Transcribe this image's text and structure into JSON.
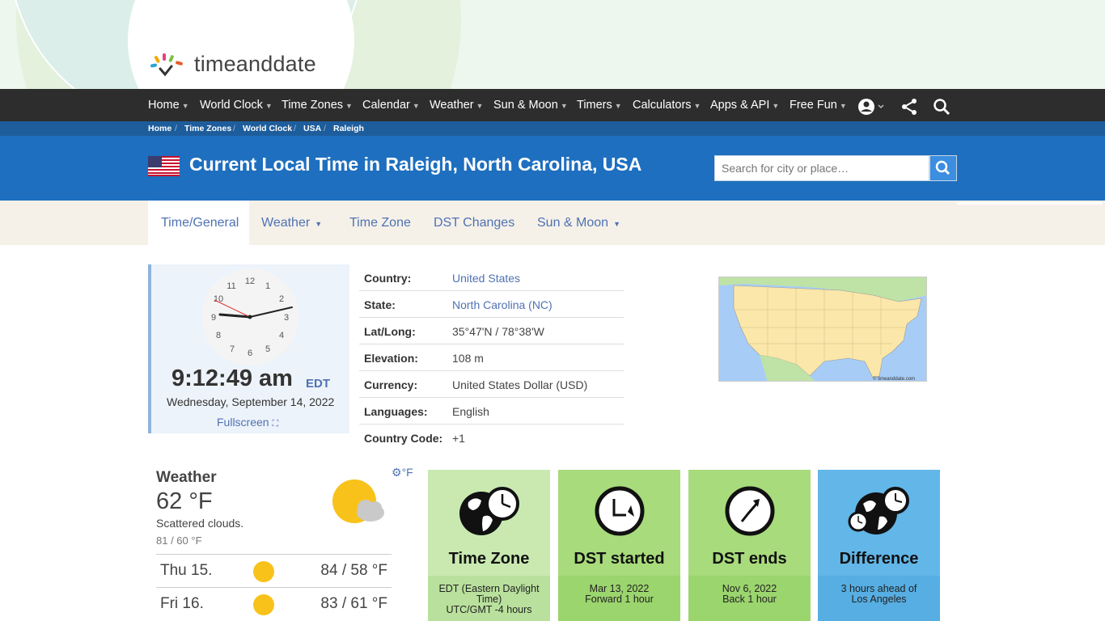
{
  "logo": {
    "text": "timeanddate"
  },
  "topnav": {
    "items": [
      "Home",
      "World Clock",
      "Time Zones",
      "Calendar",
      "Weather",
      "Sun & Moon",
      "Timers",
      "Calculators",
      "Apps & API",
      "Free Fun"
    ]
  },
  "breadcrumb": [
    "Home",
    "Time Zones",
    "World Clock",
    "USA",
    "Raleigh"
  ],
  "page": {
    "title": "Current Local Time in Raleigh, North Carolina, USA",
    "search_placeholder": "Search for city or place…"
  },
  "tabs": [
    "Time/General",
    "Weather",
    "Time Zone",
    "DST Changes",
    "Sun & Moon"
  ],
  "clock": {
    "numbers": [
      "12",
      "1",
      "2",
      "3",
      "4",
      "5",
      "6",
      "7",
      "8",
      "9",
      "10",
      "11"
    ],
    "time": "9:12:49 am",
    "tz": "EDT",
    "date": "Wednesday, September 14, 2022",
    "fullscreen": "Fullscreen"
  },
  "info": [
    {
      "k": "Country:",
      "v": "United States"
    },
    {
      "k": "State:",
      "v": "North Carolina (NC)"
    },
    {
      "k": "Lat/Long:",
      "v": "35°47'N / 78°38'W"
    },
    {
      "k": "Elevation:",
      "v": "108 m"
    },
    {
      "k": "Currency:",
      "v": "United States Dollar (USD)"
    },
    {
      "k": "Languages:",
      "v": "English"
    },
    {
      "k": "Country Code:",
      "v": "+1"
    }
  ],
  "map": {
    "credit": "© timeanddate.com"
  },
  "weather": {
    "title": "Weather",
    "temp": "62 °F",
    "desc": "Scattered clouds.",
    "hilo": "81 / 60 °F",
    "unit": "°F",
    "forecast": [
      {
        "day": "Thu 15.",
        "temps": "84 / 58 °F"
      },
      {
        "day": "Fri 16.",
        "temps": "83 / 61 °F"
      }
    ]
  },
  "cards": [
    {
      "label": "Time Zone",
      "line1": "EDT (Eastern Daylight Time)",
      "line2": "UTC/GMT -4 hours",
      "bg": "#c9e9b1",
      "sub": "#b9e19d"
    },
    {
      "label": "DST started",
      "line1": "Mar 13, 2022",
      "line2": "Forward 1 hour",
      "bg": "#a8db7b",
      "sub": "#9bd56d"
    },
    {
      "label": "DST ends",
      "line1": "Nov 6, 2022",
      "line2": "Back 1 hour",
      "bg": "#a8db7b",
      "sub": "#9bd56d"
    },
    {
      "label": "Difference",
      "line1": "3 hours ahead of",
      "line2": "Los Angeles",
      "bg": "#62b6e8",
      "sub": "#56aee3"
    }
  ]
}
